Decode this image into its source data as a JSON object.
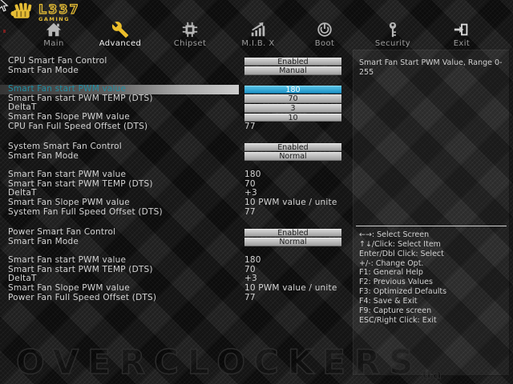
{
  "logo": {
    "title": "L337",
    "subtitle": "GAMING"
  },
  "nav": {
    "tabs": [
      {
        "label": "Main",
        "icon": "home-icon",
        "active": false
      },
      {
        "label": "Advanced",
        "icon": "wrench-icon",
        "active": true
      },
      {
        "label": "Chipset",
        "icon": "chip-icon",
        "active": false
      },
      {
        "label": "M.I.B. X",
        "icon": "chart-icon",
        "active": false
      },
      {
        "label": "Boot",
        "icon": "boot-icon",
        "active": false
      },
      {
        "label": "Security",
        "icon": "key-icon",
        "active": false
      },
      {
        "label": "Exit",
        "icon": "exit-icon",
        "active": false
      }
    ]
  },
  "settings": {
    "sections": [
      {
        "name": "cpu",
        "rows": [
          {
            "label": "CPU Smart Fan Control",
            "value": "Enabled",
            "style": "box",
            "selected": false,
            "gap": false
          },
          {
            "label": "Smart Fan Mode",
            "value": "Manual",
            "style": "box",
            "selected": false,
            "gap": false
          },
          {
            "label": "Smart Fan start PWM value",
            "value": "180",
            "style": "box",
            "selected": true,
            "gap": true
          },
          {
            "label": "Smart Fan start PWM TEMP (DTS)",
            "value": "70",
            "style": "box",
            "selected": false,
            "gap": false
          },
          {
            "label": "DeltaT",
            "value": "3",
            "style": "box",
            "selected": false,
            "gap": false
          },
          {
            "label": "Smart Fan Slope PWM value",
            "value": "10",
            "style": "box",
            "selected": false,
            "gap": false
          },
          {
            "label": "CPU Fan Full Speed Offset (DTS)",
            "value": "77",
            "style": "text",
            "selected": false,
            "gap": false
          }
        ]
      },
      {
        "name": "system",
        "rows": [
          {
            "label": "System Smart Fan Control",
            "value": "Enabled",
            "style": "box",
            "selected": false,
            "gap": false
          },
          {
            "label": "Smart Fan Mode",
            "value": "Normal",
            "style": "box",
            "selected": false,
            "gap": false
          },
          {
            "label": "Smart Fan start PWM value",
            "value": "180",
            "style": "text",
            "selected": false,
            "gap": true
          },
          {
            "label": "Smart Fan start PWM TEMP (DTS)",
            "value": "70",
            "style": "text",
            "selected": false,
            "gap": false
          },
          {
            "label": "DeltaT",
            "value": "+3",
            "style": "text",
            "selected": false,
            "gap": false
          },
          {
            "label": "Smart Fan Slope PWM value",
            "value": "10 PWM value / unite",
            "style": "text",
            "selected": false,
            "gap": false
          },
          {
            "label": "System Fan Full Speed Offset (DTS)",
            "value": "77",
            "style": "text",
            "selected": false,
            "gap": false
          }
        ]
      },
      {
        "name": "power",
        "rows": [
          {
            "label": "Power Smart Fan Control",
            "value": "Enabled",
            "style": "box",
            "selected": false,
            "gap": false
          },
          {
            "label": "Smart Fan Mode",
            "value": "Normal",
            "style": "box",
            "selected": false,
            "gap": false
          },
          {
            "label": "Smart Fan start PWM value",
            "value": "180",
            "style": "text",
            "selected": false,
            "gap": true
          },
          {
            "label": "Smart Fan start PWM TEMP (DTS)",
            "value": "70",
            "style": "text",
            "selected": false,
            "gap": false
          },
          {
            "label": "DeltaT",
            "value": "+3",
            "style": "text",
            "selected": false,
            "gap": false
          },
          {
            "label": "Smart Fan Slope PWM value",
            "value": "10 PWM value / unite",
            "style": "text",
            "selected": false,
            "gap": false
          },
          {
            "label": "Power Fan Full Speed Offset (DTS)",
            "value": "77",
            "style": "text",
            "selected": false,
            "gap": false
          }
        ]
      }
    ]
  },
  "help": {
    "description": "Smart Fan Start PWM Value, Range 0-255"
  },
  "hotkeys": [
    "←→: Select Screen",
    "↑↓/Click: Select Item",
    "Enter/Dbl Click: Select",
    "+/-: Change Opt.",
    "F1: General Help",
    "F2: Previous Values",
    "F3: Optimized Defaults",
    "F4: Save & Exit",
    "F9: Capture screen",
    "ESC/Right Click: Exit"
  ],
  "watermark": {
    "text": "OVERCLOCKERS",
    "suffix": "ua"
  },
  "colors": {
    "accent": "#e6bd35",
    "selected": "#2ba7d8",
    "box": "#b8b8b8",
    "background": "#131313"
  }
}
